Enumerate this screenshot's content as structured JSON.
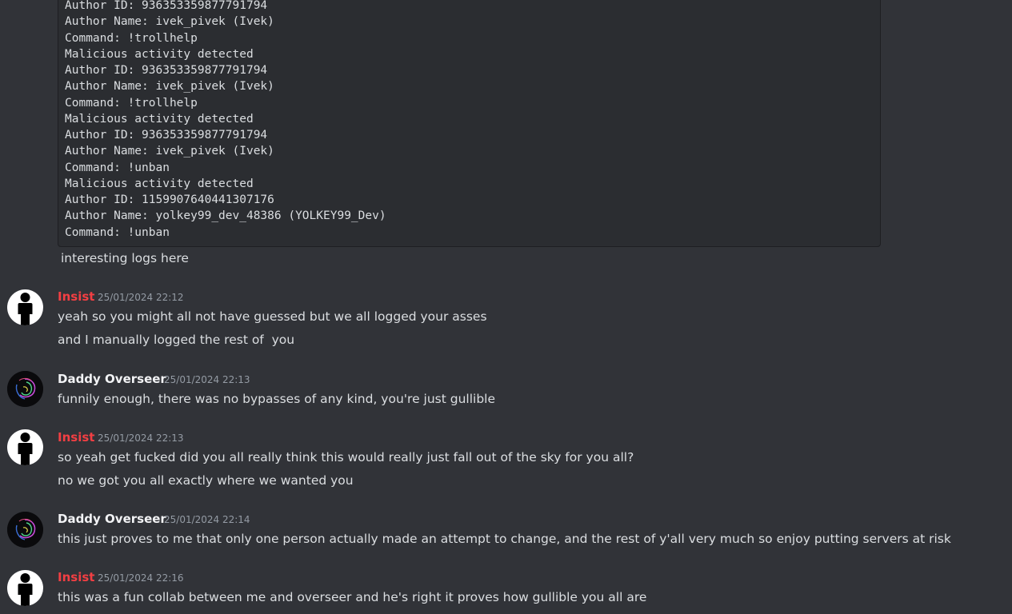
{
  "code_block": {
    "lines": [
      "Author ID: 936353359877791794",
      "Author Name: ivek_pivek (Ivek)",
      "Command: !trollhelp",
      "Malicious activity detected",
      "Author ID: 936353359877791794",
      "Author Name: ivek_pivek (Ivek)",
      "Command: !trollhelp",
      "Malicious activity detected",
      "Author ID: 936353359877791794",
      "Author Name: ivek_pivek (Ivek)",
      "Command: !unban",
      "Malicious activity detected",
      "Author ID: 1159907640441307176",
      "Author Name: yolkey99_dev_48386 (YOLKEY99_Dev)",
      "Command: !unban"
    ],
    "trailing_text": "interesting logs here"
  },
  "messages": [
    {
      "author": "Insist",
      "author_color": "#f23f43",
      "avatar": "person-silhouette-icon",
      "timestamp": "25/01/2024 22:12",
      "lines": [
        "yeah so you might all not have guessed but we all logged your asses",
        "and I manually logged the rest of  you"
      ]
    },
    {
      "author": "Daddy Overseer",
      "author_color": "#f2f3f5",
      "avatar": "swirl-avatar-icon",
      "timestamp": "25/01/2024 22:13",
      "lines": [
        "funnily enough, there was no bypasses of any kind, you're just gullible"
      ]
    },
    {
      "author": "Insist",
      "author_color": "#f23f43",
      "avatar": "person-silhouette-icon",
      "timestamp": "25/01/2024 22:13",
      "lines": [
        "so yeah get fucked did you all really think this would really just fall out of the sky for you all?",
        "no we got you all exactly where we wanted you"
      ]
    },
    {
      "author": "Daddy Overseer",
      "author_color": "#f2f3f5",
      "avatar": "swirl-avatar-icon",
      "timestamp": "25/01/2024 22:14",
      "lines": [
        "this just proves to me that only one person actually made an attempt to change, and the rest of y'all very much so enjoy putting servers at risk"
      ]
    },
    {
      "author": "Insist",
      "author_color": "#f23f43",
      "avatar": "person-silhouette-icon",
      "timestamp": "25/01/2024 22:16",
      "lines": [
        "this was a fun collab between me and overseer and he's right it proves how gullible you all are"
      ]
    }
  ]
}
